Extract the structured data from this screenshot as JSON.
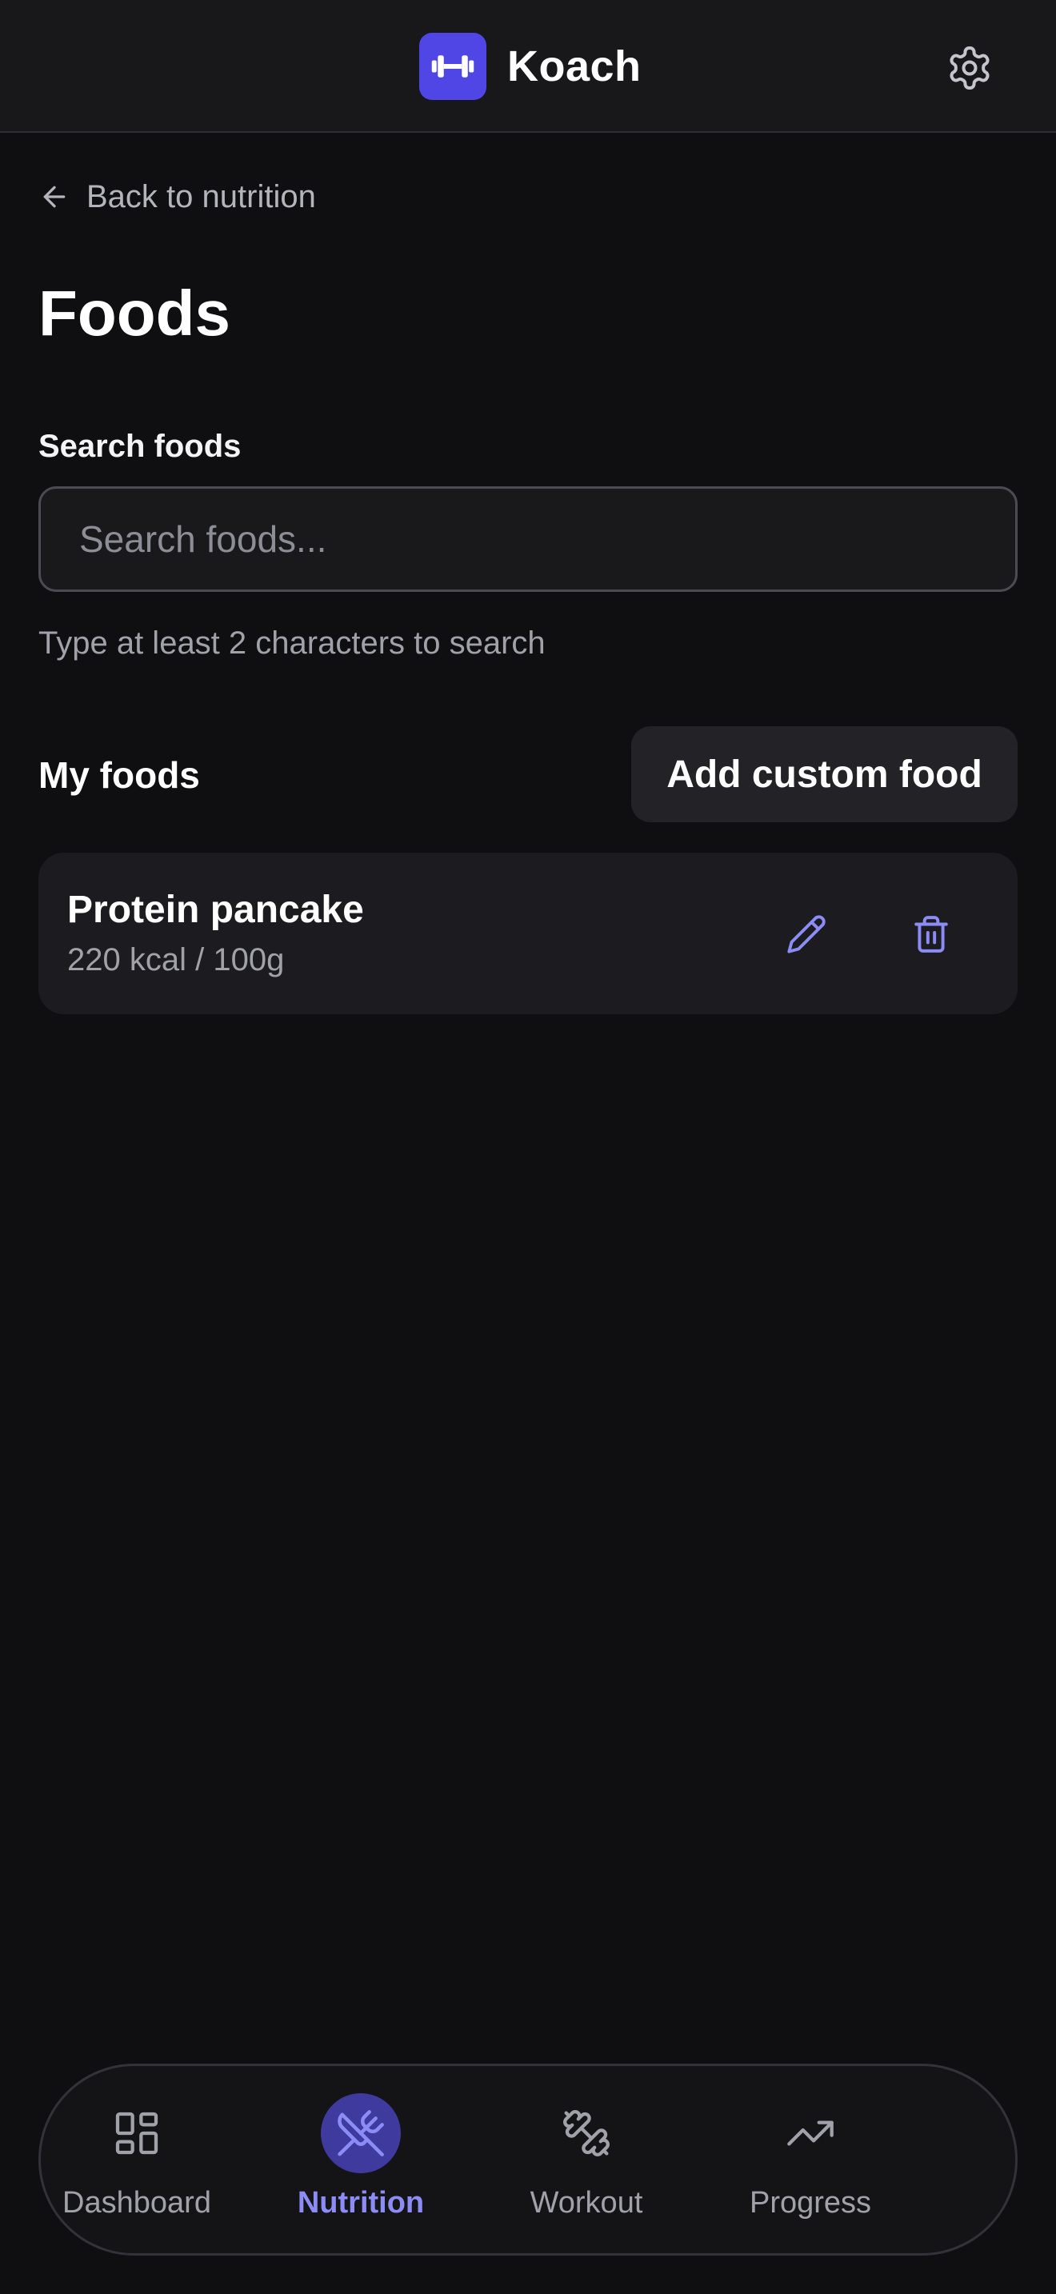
{
  "app": {
    "name": "Koach",
    "logo_icon": "dumbbell-icon",
    "settings_icon": "gear-icon"
  },
  "back_link": {
    "label": "Back to nutrition",
    "icon": "arrow-left-icon"
  },
  "page": {
    "title": "Foods"
  },
  "search": {
    "label": "Search foods",
    "placeholder": "Search foods...",
    "value": "",
    "hint": "Type at least 2 characters to search"
  },
  "my_foods": {
    "title": "My foods",
    "add_button": "Add custom food",
    "items": [
      {
        "name": "Protein pancake",
        "meta": "220 kcal / 100g",
        "edit_icon": "pencil-icon",
        "delete_icon": "trash-icon"
      }
    ]
  },
  "nav": {
    "items": [
      {
        "label": "Dashboard",
        "icon": "grid-icon",
        "active": false
      },
      {
        "label": "Nutrition",
        "icon": "utensils-icon",
        "active": true
      },
      {
        "label": "Workout",
        "icon": "dumbbell-icon",
        "active": false
      },
      {
        "label": "Progress",
        "icon": "trending-up-icon",
        "active": false
      }
    ]
  },
  "colors": {
    "background": "#0f0f11",
    "surface": "#1c1c20",
    "accent": "#8b8cf6",
    "brand": "#4f46e5",
    "muted_text": "#a1a1aa"
  }
}
